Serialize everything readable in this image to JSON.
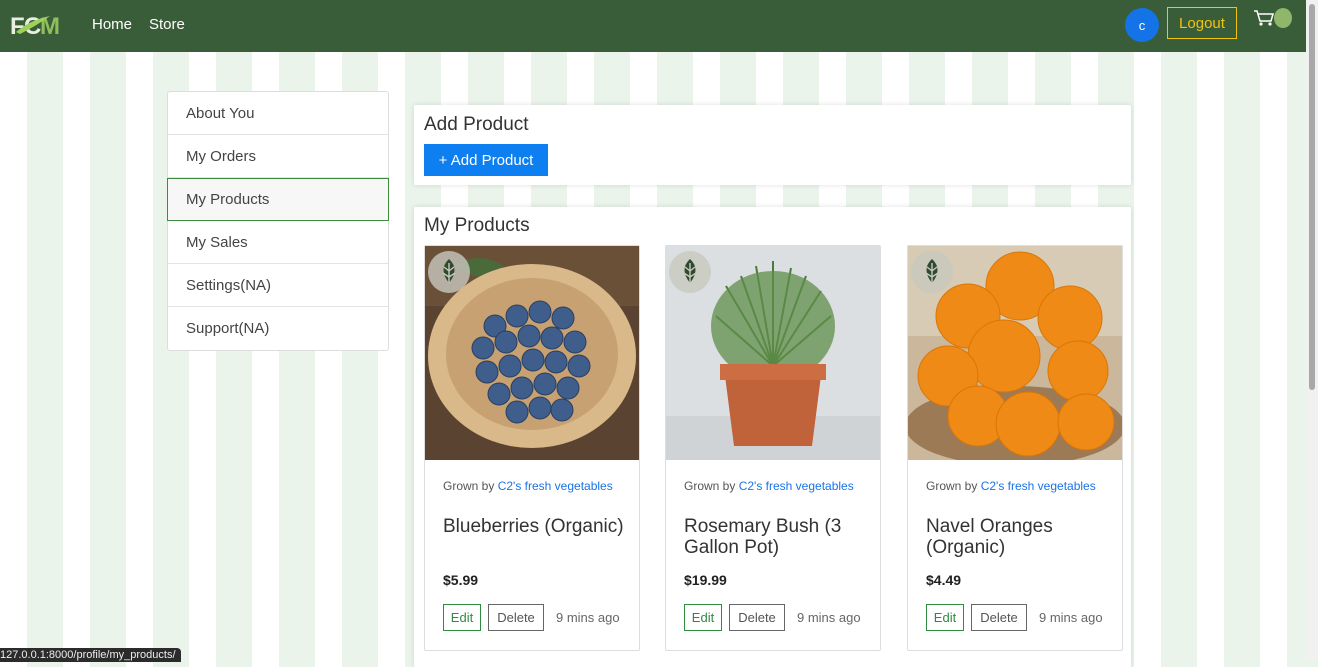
{
  "nav": {
    "home": "Home",
    "store": "Store",
    "avatar_initial": "c",
    "logout": "Logout"
  },
  "sidebar": {
    "items": [
      {
        "label": "About You"
      },
      {
        "label": "My Orders"
      },
      {
        "label": "My Products",
        "active": true
      },
      {
        "label": "My Sales"
      },
      {
        "label": "Settings(NA)"
      },
      {
        "label": "Support(NA)"
      }
    ]
  },
  "add_panel": {
    "title": "Add Product",
    "button": "+ Add Product"
  },
  "products_panel": {
    "title": "My Products",
    "products": [
      {
        "grown_prefix": "Grown by",
        "farm": "C2's fresh vegetables",
        "name": "Blueberries (Organic)",
        "price": "$5.99",
        "edit": "Edit",
        "delete": "Delete",
        "ago": "9 mins ago",
        "image": "blueberries-bowl"
      },
      {
        "grown_prefix": "Grown by",
        "farm": "C2's fresh vegetables",
        "name": "Rosemary Bush (3 Gallon Pot)",
        "price": "$19.99",
        "edit": "Edit",
        "delete": "Delete",
        "ago": "9 mins ago",
        "image": "rosemary-pot"
      },
      {
        "grown_prefix": "Grown by",
        "farm": "C2's fresh vegetables",
        "name": "Navel Oranges (Organic)",
        "price": "$4.49",
        "edit": "Edit",
        "delete": "Delete",
        "ago": "9 mins ago",
        "image": "oranges-bowl"
      }
    ]
  },
  "status_bar": {
    "url": "127.0.0.1:8000/profile/my_products/"
  },
  "colors": {
    "navbar": "#395c39",
    "accent": "#0d7ff0",
    "logout": "#f1c40f",
    "edit": "#2e8b3f"
  }
}
